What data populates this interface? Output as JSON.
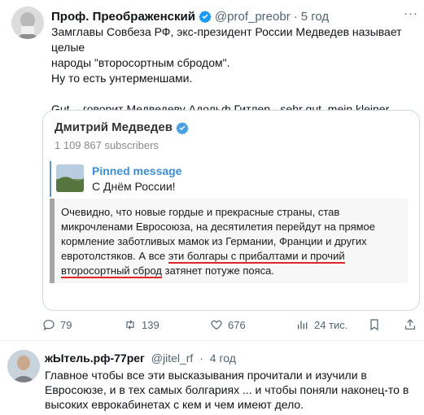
{
  "tweet": {
    "author_name": "Проф. Преображенский",
    "handle": "@prof_preobr",
    "separator": "·",
    "time": "5 год",
    "more_label": "···",
    "lines": [
      "Замглавы Совбеза РФ, экс-президент России Медведев называет целые",
      "народы \"второсортным сбродом\".",
      "Ну то есть унтерменшами."
    ],
    "last_line": "Gut, - говорит Медведеву Адольф Гитлер - sehr gut, mein kleiner Nazi.",
    "embed": {
      "channel_name": "Дмитрий Медведев",
      "subscribers": "1 109 867 subscribers",
      "pinned_title": "Pinned message",
      "pinned_text": "С Днём России!",
      "quote_part1": "Очевидно, что новые гордые и прекрасные страны, став микрочленами Евросоюза, на десятилетия перейдут на прямое кормление заботливых мамок из Германии, Франции и других евротолстяков. А все ",
      "quote_underlined1": "эти болгары с прибалтами и прочий",
      "quote_space": " ",
      "quote_underlined2": "второсортный сброд",
      "quote_part2": " затянет потуже пояса."
    },
    "actions": {
      "replies": "79",
      "retweets": "139",
      "likes": "676",
      "views": "24 тис."
    },
    "colors": {
      "accent": "#1d9bf0",
      "underline": "#e0242a",
      "pinned": "#3d8fd1"
    }
  },
  "reply": {
    "author_name": "жЫтель.рф-77рег",
    "handle": "@jitel_rf",
    "separator": "·",
    "time": "4 год",
    "text": "Главное чтобы все эти высказывания прочитали и изучили в Евросоюзе, и в тех самых болгариях ... и чтобы поняли наконец-то в высоких еврокабинетах с кем и чем имеют дело."
  }
}
